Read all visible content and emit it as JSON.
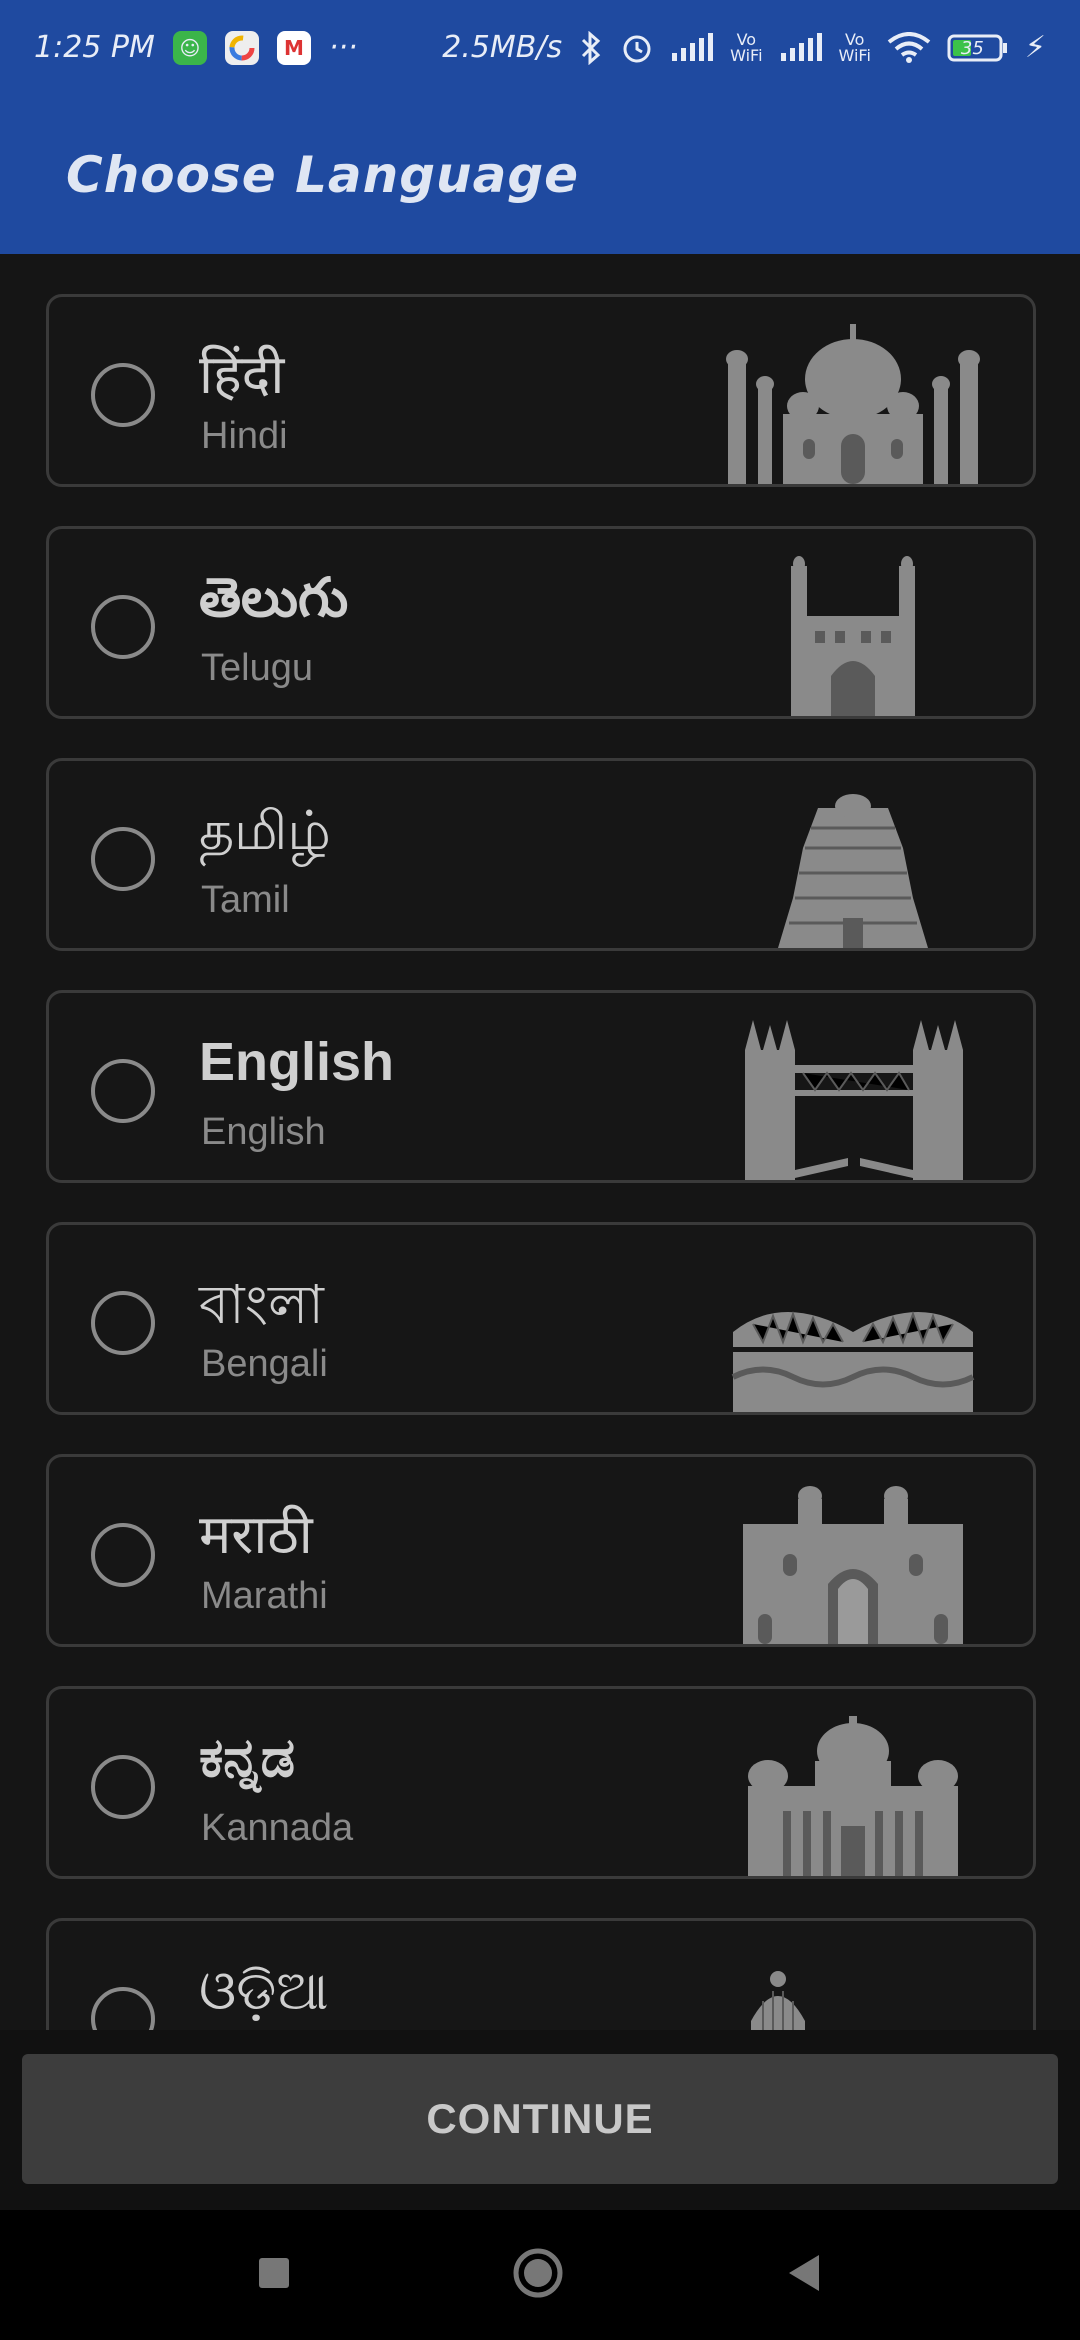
{
  "status_bar": {
    "time": "1:25 PM",
    "more": "···",
    "speed": "2.5MB/s",
    "vowifi_top": "Vo",
    "vowifi_bottom": "WiFi",
    "battery": "35"
  },
  "app_bar": {
    "title": "Choose Language"
  },
  "languages": [
    {
      "native": "हिंदी",
      "english": "Hindi",
      "landmark": "taj-mahal-icon"
    },
    {
      "native": "తెలుగు",
      "english": "Telugu",
      "landmark": "charminar-icon"
    },
    {
      "native": "தமிழ்",
      "english": "Tamil",
      "landmark": "temple-gopuram-icon"
    },
    {
      "native": "English",
      "english": "English",
      "landmark": "tower-bridge-icon"
    },
    {
      "native": "বাংলা",
      "english": "Bengali",
      "landmark": "howrah-bridge-icon"
    },
    {
      "native": "मराठी",
      "english": "Marathi",
      "landmark": "gateway-of-india-icon"
    },
    {
      "native": "ಕನ್ನಡ",
      "english": "Kannada",
      "landmark": "vidhana-soudha-icon"
    },
    {
      "native": "ଓଡ଼ିଆ",
      "english": "",
      "landmark": "konark-temple-icon"
    }
  ],
  "continue_label": "CONTINUE",
  "colors": {
    "primary": "#1f4aa0",
    "background": "#151515",
    "card_border": "#3a3a3a",
    "button": "#3d3d3d"
  }
}
